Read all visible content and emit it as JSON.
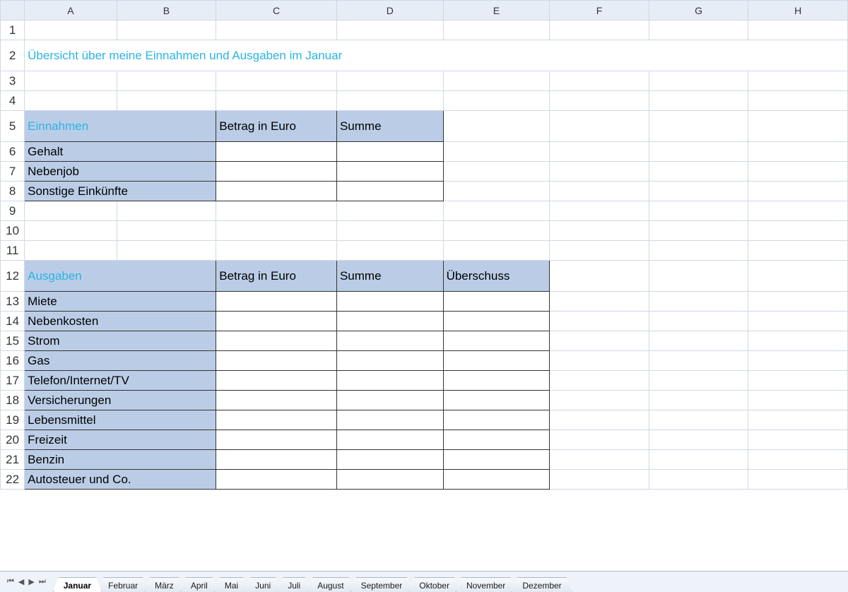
{
  "columns": [
    "A",
    "B",
    "C",
    "D",
    "E",
    "F",
    "G",
    "H"
  ],
  "rows": [
    1,
    2,
    3,
    4,
    5,
    6,
    7,
    8,
    9,
    10,
    11,
    12,
    13,
    14,
    15,
    16,
    17,
    18,
    19,
    20,
    21,
    22
  ],
  "title": "Übersicht über meine Einnahmen und Ausgaben im Januar",
  "einnahmen": {
    "heading": "Einnahmen",
    "col_betrag": "Betrag in Euro",
    "col_summe": "Summe",
    "rows": [
      "Gehalt",
      "Nebenjob",
      "Sonstige Einkünfte"
    ]
  },
  "ausgaben": {
    "heading": "Ausgaben",
    "col_betrag": "Betrag in Euro",
    "col_summe": "Summe",
    "col_ueberschuss": "Überschuss",
    "rows": [
      "Miete",
      "Nebenkosten",
      "Strom",
      "Gas",
      "Telefon/Internet/TV",
      "Versicherungen",
      "Lebensmittel",
      "Freizeit",
      "Benzin",
      "Autosteuer und Co."
    ]
  },
  "tabs": [
    "Januar",
    "Februar",
    "März",
    "April",
    "Mai",
    "Juni",
    "Juli",
    "August",
    "September",
    "Oktober",
    "November",
    "Dezember"
  ],
  "active_tab": "Januar",
  "nav": {
    "first": "⏮",
    "prev": "◀",
    "next": "▶",
    "last": "⏭"
  }
}
